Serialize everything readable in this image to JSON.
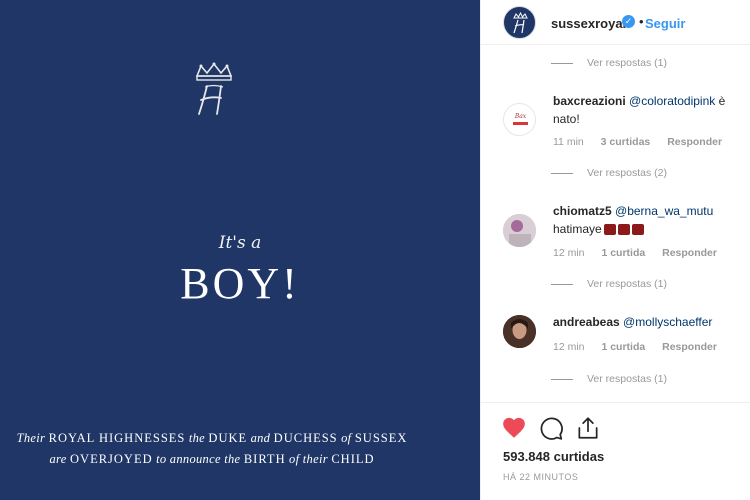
{
  "post": {
    "its_a": "It's a",
    "boy": "BOY!",
    "line1": {
      "w1": "Their",
      "w2": "ROYAL HIGHNESSES",
      "w3": "the",
      "w4": "DUKE",
      "w5": "and",
      "w6": "DUCHESS",
      "w7": "of",
      "w8": "SUSSEX"
    },
    "line2": {
      "w1": "are",
      "w2": "OVERJOYED",
      "w3": "to announce the",
      "w4": "BIRTH",
      "w5": "of their",
      "w6": "CHILD"
    }
  },
  "header": {
    "username": "sussexroyal",
    "dot": "•",
    "follow_label": "Seguir"
  },
  "replies": {
    "r1": "Ver respostas (1)",
    "r2": "Ver respostas (2)",
    "r3": "Ver respostas (1)",
    "r4": "Ver respostas (1)"
  },
  "comments": [
    {
      "username": "baxcreazioni",
      "mention": "@coloratodipink",
      "text_a": " è",
      "text_b": "nato!",
      "time": "11 min",
      "likes": "3 curtidas",
      "reply": "Responder"
    },
    {
      "username": "chiomatz5",
      "mention": "@berna_wa_mutu",
      "text_b": "hatimaye",
      "time": "12 min",
      "likes": "1 curtida",
      "reply": "Responder"
    },
    {
      "username": "andreabeas",
      "mention": "@mollyschaeffer",
      "time": "12 min",
      "likes": "1 curtida",
      "reply": "Responder"
    }
  ],
  "footer": {
    "likes": "593.848 curtidas",
    "time_ago": "HÁ 22 MINUTOS"
  },
  "colors": {
    "brand": "#1f3666",
    "link": "#3897f0",
    "heart": "#ed4956"
  }
}
